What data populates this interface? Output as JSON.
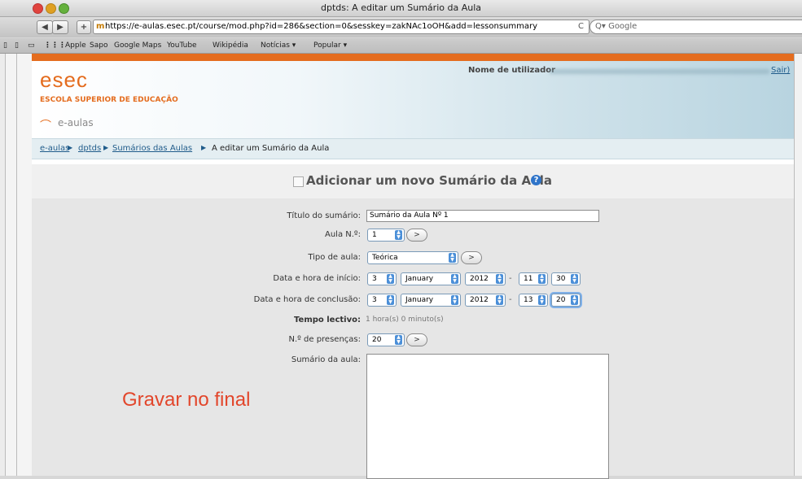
{
  "window": {
    "title": "dptds: A editar um Sumário da Aula"
  },
  "nav": {
    "back_label": "◀",
    "forward_label": "▶",
    "add_label": "+",
    "url": "https://e-aulas.esec.pt/course/mod.php?id=286&section=0&sesskey=zakNAc1oOH&add=lessonsummary",
    "reload_label": "C",
    "search_placeholder": "Q▾ Google"
  },
  "bookmarks": [
    "Apple",
    "Sapo",
    "Google Maps",
    "YouTube",
    "Wikipédia",
    "Notícias ▾",
    "Popular ▾"
  ],
  "header": {
    "logo": "esec",
    "school_name": "ESCOLA SUPERIOR DE EDUCAÇÃO",
    "site_name": "e-aulas",
    "user_label": "Nome de utilizador",
    "logout": "Sair)",
    "colors": {
      "accent": "#e46c1e",
      "header_band": "#b8d4e0",
      "link": "#1f5b8a"
    }
  },
  "breadcrumb": {
    "items": [
      "e-aulas",
      "dptds",
      "Sumários das Aulas"
    ],
    "current": "A editar um Sumário da Aula",
    "separator": "▶"
  },
  "form": {
    "title": "Adicionar um novo Sumário da Aula",
    "help_icon": "question-icon",
    "fields": {
      "titulo": {
        "label": "Título do sumário:",
        "value": "Sumário da Aula Nº 1"
      },
      "aula": {
        "label": "Aula N.º:",
        "value": "1",
        "go": ">"
      },
      "tipo": {
        "label": "Tipo de aula:",
        "value": "Teórica",
        "go": ">"
      },
      "inicio": {
        "label": "Data e hora de início:",
        "day": "3",
        "month": "January",
        "year": "2012",
        "sep": "-",
        "hour": "11",
        "minute": "30"
      },
      "conclusao": {
        "label": "Data e hora de conclusão:",
        "day": "3",
        "month": "January",
        "year": "2012",
        "sep": "-",
        "hour": "13",
        "minute": "20"
      },
      "tempo": {
        "label": "Tempo lectivo:",
        "value": "1 hora(s) 0 minuto(s)"
      },
      "presencas": {
        "label": "N.º de presenças:",
        "value": "20",
        "go": ">"
      },
      "sumario": {
        "label": "Sumário da aula:",
        "value": ""
      }
    },
    "annotation": "Gravar no final"
  }
}
